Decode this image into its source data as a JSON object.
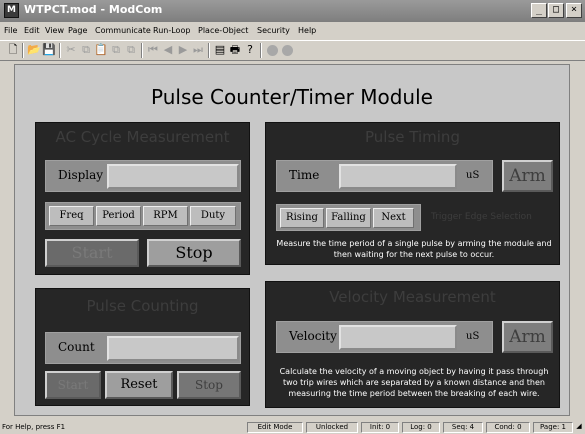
{
  "window": {
    "title": "WTPCT.mod - ModCom",
    "icon_letter": "M"
  },
  "menu": [
    "File",
    "Edit",
    "View",
    "Page",
    "Communicate",
    "Run-Loop",
    "Place-Object",
    "Security",
    "Help"
  ],
  "main_title": "Pulse Counter/Timer Module",
  "ac_cycle": {
    "title": "AC Cycle Measurement",
    "display_label": "Display",
    "display_value": "",
    "modes": [
      "Freq",
      "Period",
      "RPM",
      "Duty"
    ],
    "start_label": "Start",
    "stop_label": "Stop"
  },
  "pulse_timing": {
    "title": "Pulse Timing",
    "time_label": "Time",
    "time_value": "",
    "time_unit": "uS",
    "arm_label": "Arm",
    "edges": [
      "Rising",
      "Falling",
      "Next"
    ],
    "edge_caption": "Trigger Edge Selection",
    "description": "Measure the time period of a single pulse by arming the module and then waiting for the next pulse to occur."
  },
  "pulse_counting": {
    "title": "Pulse Counting",
    "count_label": "Count",
    "count_value": "",
    "start_label": "Start",
    "reset_label": "Reset",
    "stop_label": "Stop"
  },
  "velocity": {
    "title": "Velocity Measurement",
    "velocity_label": "Velocity",
    "velocity_value": "",
    "unit": "uS",
    "arm_label": "Arm",
    "description": "Calculate the velocity of a moving object by having it pass through two trip wires which are separated by a known distance and then measuring the time period between the breaking of each wire."
  },
  "status": {
    "help": "For Help, press F1",
    "mode": "Edit Mode",
    "lock": "Unlocked",
    "init": "Init: 0",
    "log": "Log: 0",
    "seq": "Seq: 4",
    "cond": "Cond: 0",
    "page": "Page: 1"
  }
}
